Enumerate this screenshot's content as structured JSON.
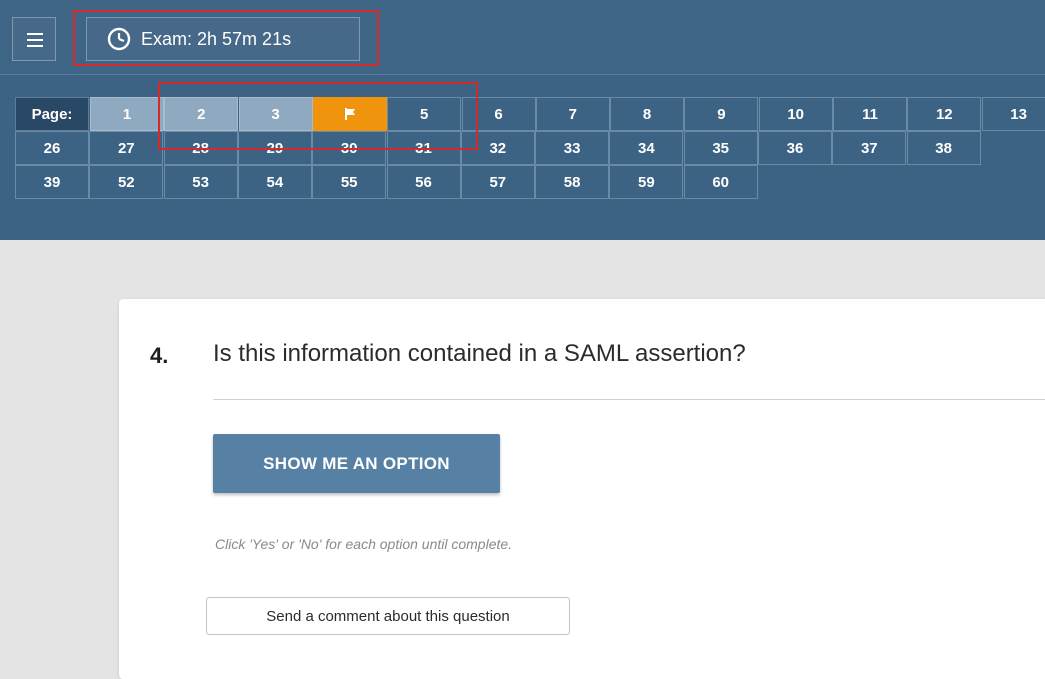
{
  "header": {
    "menu_icon": "hamburger-icon",
    "timer_icon": "stopwatch-icon",
    "timer_label": "Exam: 2h 57m 21s"
  },
  "pagination": {
    "label": "Page:",
    "pages": [
      {
        "label": "1",
        "state": "visited"
      },
      {
        "label": "2",
        "state": "visited"
      },
      {
        "label": "3",
        "state": "visited"
      },
      {
        "label": "",
        "state": "flagged",
        "icon": "flag-icon"
      },
      {
        "label": "5",
        "state": "default"
      },
      {
        "label": "6",
        "state": "default"
      },
      {
        "label": "7",
        "state": "default"
      },
      {
        "label": "8",
        "state": "default"
      },
      {
        "label": "9",
        "state": "default"
      },
      {
        "label": "10",
        "state": "default"
      },
      {
        "label": "11",
        "state": "default"
      },
      {
        "label": "12",
        "state": "default"
      },
      {
        "label": "13",
        "state": "default"
      },
      {
        "label": "26",
        "state": "default"
      },
      {
        "label": "27",
        "state": "default"
      },
      {
        "label": "28",
        "state": "crossed"
      },
      {
        "label": "29",
        "state": "crossed"
      },
      {
        "label": "30",
        "state": "crossed"
      },
      {
        "label": "31",
        "state": "crossed"
      },
      {
        "label": "32",
        "state": "default"
      },
      {
        "label": "33",
        "state": "default"
      },
      {
        "label": "34",
        "state": "default"
      },
      {
        "label": "35",
        "state": "default"
      },
      {
        "label": "36",
        "state": "default"
      },
      {
        "label": "37",
        "state": "default"
      },
      {
        "label": "38",
        "state": "default"
      },
      {
        "label": "39",
        "state": "default"
      },
      {
        "label": "52",
        "state": "default"
      },
      {
        "label": "53",
        "state": "default"
      },
      {
        "label": "54",
        "state": "default"
      },
      {
        "label": "55",
        "state": "default"
      },
      {
        "label": "56",
        "state": "default"
      },
      {
        "label": "57",
        "state": "default"
      },
      {
        "label": "58",
        "state": "default"
      },
      {
        "label": "59",
        "state": "default"
      },
      {
        "label": "60",
        "state": "default"
      }
    ]
  },
  "question": {
    "number": "4.",
    "text": "Is this information contained in a SAML assertion?",
    "show_option_label": "SHOW ME AN OPTION",
    "hint": "Click 'Yes' or 'No' for each option until complete.",
    "comment_label": "Send a comment about this question"
  },
  "colors": {
    "header_bg": "#3d6384",
    "visited_page": "#8fa9c0",
    "flagged_page": "#f0940d",
    "primary_button": "#5681a5",
    "annotation": "#d42a2a"
  }
}
